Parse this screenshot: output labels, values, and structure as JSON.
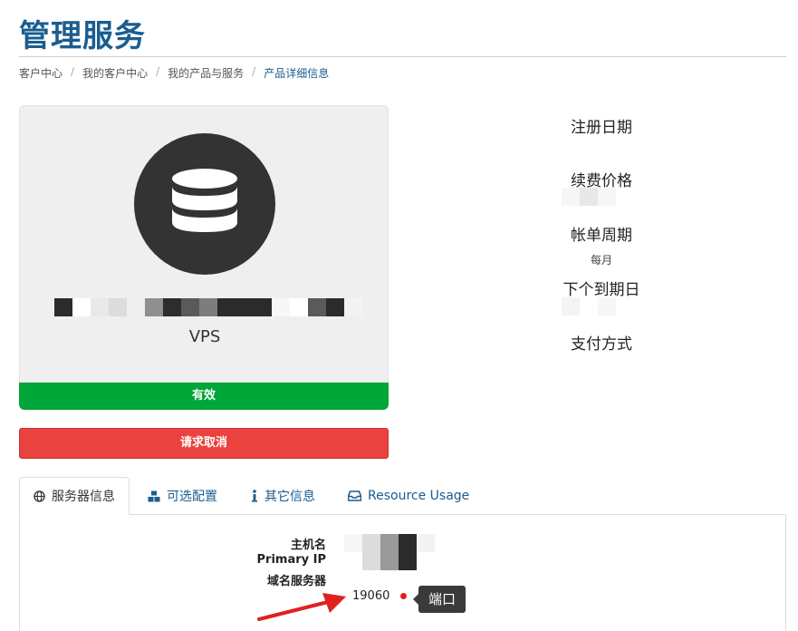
{
  "page": {
    "title": "管理服务"
  },
  "breadcrumb": [
    "客户中心",
    "我的客户中心",
    "我的产品与服务",
    "产品详细信息"
  ],
  "product": {
    "icon": "database-icon",
    "group": "VPS",
    "status": "有效"
  },
  "actions": {
    "cancel_label": "请求取消"
  },
  "details": {
    "registration_date_label": "注册日期",
    "renewal_price_label": "续费价格",
    "billing_cycle_label": "帐单周期",
    "billing_cycle_value": "每月",
    "next_due_date_label": "下个到期日",
    "payment_method_label": "支付方式"
  },
  "tabs": [
    {
      "label": "服务器信息",
      "icon": "globe-icon",
      "active": true
    },
    {
      "label": "可选配置",
      "icon": "cubes-icon",
      "active": false
    },
    {
      "label": "其它信息",
      "icon": "info-icon",
      "active": false
    },
    {
      "label": "Resource Usage",
      "icon": "inbox-icon",
      "active": false
    }
  ],
  "server_info": {
    "hostname_label": "主机名",
    "primary_ip_label": "Primary IP",
    "nameservers_label": "域名服务器",
    "port_value": "19060"
  },
  "annotation": {
    "tooltip": "端口"
  },
  "colors": {
    "brand": "#1a5d8f",
    "status_active": "#00a637",
    "cancel": "#e9423f",
    "annotation": "#e02020"
  }
}
